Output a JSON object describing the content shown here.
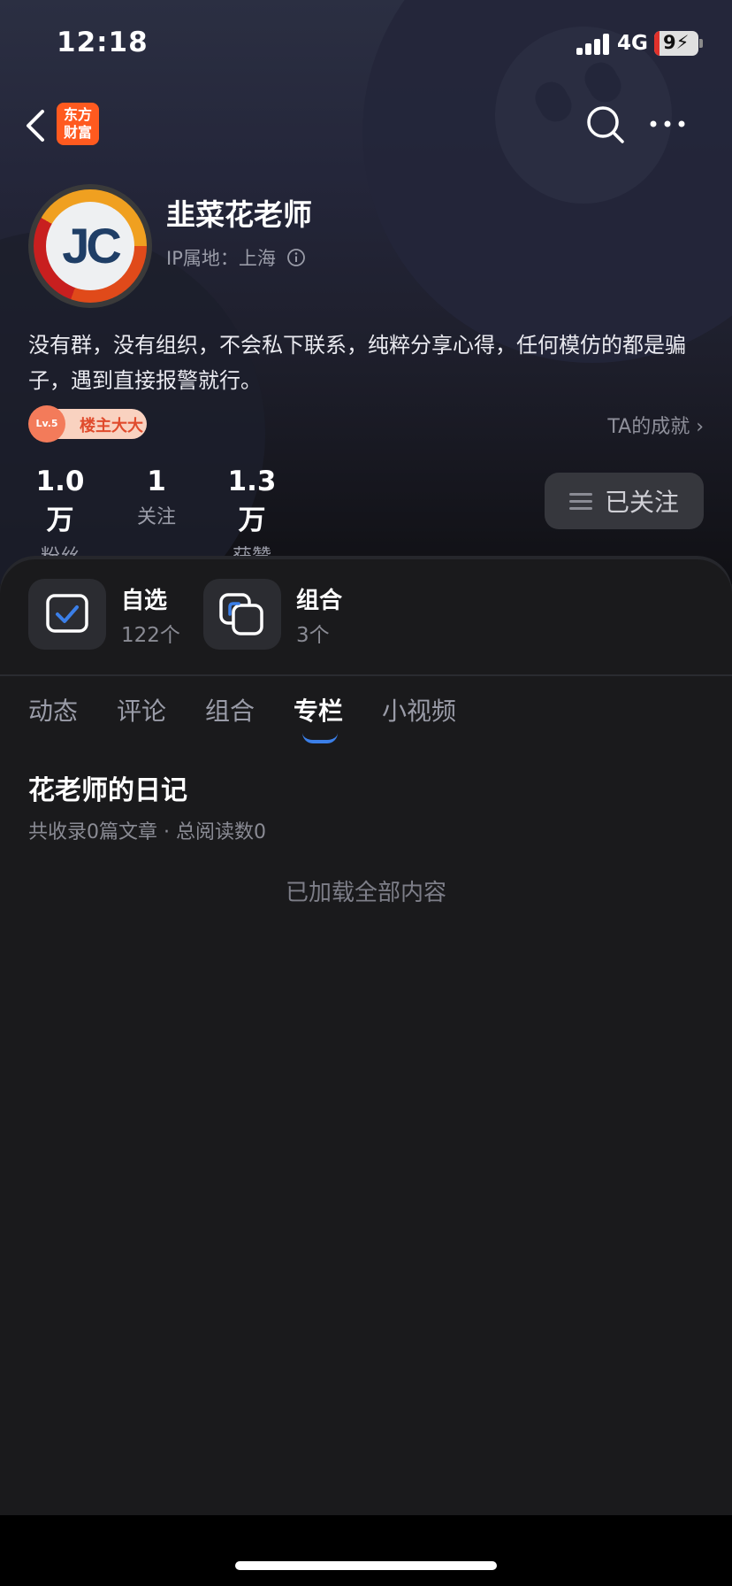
{
  "status_bar": {
    "time": "12:18",
    "network": "4G",
    "battery": "9"
  },
  "nav": {
    "app_logo_line1": "东方",
    "app_logo_line2": "财富"
  },
  "profile": {
    "avatar_text": "JC",
    "name": "韭菜花老师",
    "ip_location": "IP属地：上海",
    "bio": "没有群，没有组织，不会私下联系，纯粹分享心得，任何模仿的都是骗子，遇到直接报警就行。",
    "level_badge": "Lv.5",
    "level_title": "楼主大大",
    "achievements_link": "TA的成就 ›"
  },
  "stats": [
    {
      "value": "1.0万",
      "label": "粉丝"
    },
    {
      "value": "1",
      "label": "关注"
    },
    {
      "value": "1.3万",
      "label": "获赞"
    }
  ],
  "follow_button": "已关注",
  "shortcuts": [
    {
      "title": "自选",
      "count": "122个"
    },
    {
      "title": "组合",
      "count": "3个"
    }
  ],
  "tabs": [
    "动态",
    "评论",
    "组合",
    "专栏",
    "小视频"
  ],
  "active_tab": "专栏",
  "column": {
    "title": "花老师的日记",
    "meta": "共收录0篇文章 · 总阅读数0",
    "loaded_text": "已加载全部内容"
  },
  "colors": {
    "accent": "#3b7fe8",
    "brand": "#ff5a1f",
    "background": "#1a1a1c"
  }
}
